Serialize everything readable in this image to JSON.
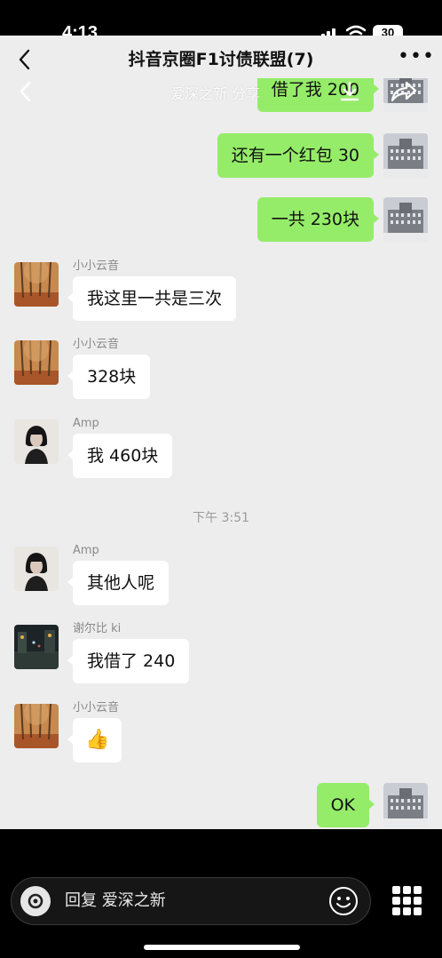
{
  "status_bar": {
    "time": "4:13",
    "battery": "30"
  },
  "header": {
    "title": "抖音京圈F1讨债联盟(7)",
    "more_label": "•••"
  },
  "media_overlay": {
    "caption": "爱深之新 分享"
  },
  "messages": [
    {
      "text": "借了我 200",
      "sender": "",
      "from_me": true,
      "avatar": "building-avatar"
    },
    {
      "text": "还有一个红包 30",
      "sender": "",
      "from_me": true,
      "avatar": "building-avatar"
    },
    {
      "text": "一共 230块",
      "sender": "",
      "from_me": true,
      "avatar": "building-avatar"
    },
    {
      "text": "我这里一共是三次",
      "sender": "小小云音",
      "from_me": false,
      "avatar": "autumn-trees-avatar"
    },
    {
      "text": "328块",
      "sender": "小小云音",
      "from_me": false,
      "avatar": "autumn-trees-avatar"
    },
    {
      "text": "我 460块",
      "sender": "Amp",
      "from_me": false,
      "avatar": "dark-hair-girl-avatar"
    },
    {
      "text": "其他人呢",
      "sender": "Amp",
      "from_me": false,
      "avatar": "dark-hair-girl-avatar"
    },
    {
      "text": "我借了 240",
      "sender": "谢尔比 ki",
      "from_me": false,
      "avatar": "night-street-avatar"
    },
    {
      "text": "👍",
      "sender": "小小云音",
      "from_me": false,
      "avatar": "autumn-trees-avatar"
    },
    {
      "text": "OK",
      "sender": "",
      "from_me": true,
      "avatar": "building-avatar"
    }
  ],
  "timestamp": "下午 3:51",
  "input_bar": {
    "placeholder": "回复 爱深之新"
  },
  "colors": {
    "my_bubble": "#95ec69",
    "other_bubble": "#ffffff",
    "chat_background": "#ededed"
  }
}
